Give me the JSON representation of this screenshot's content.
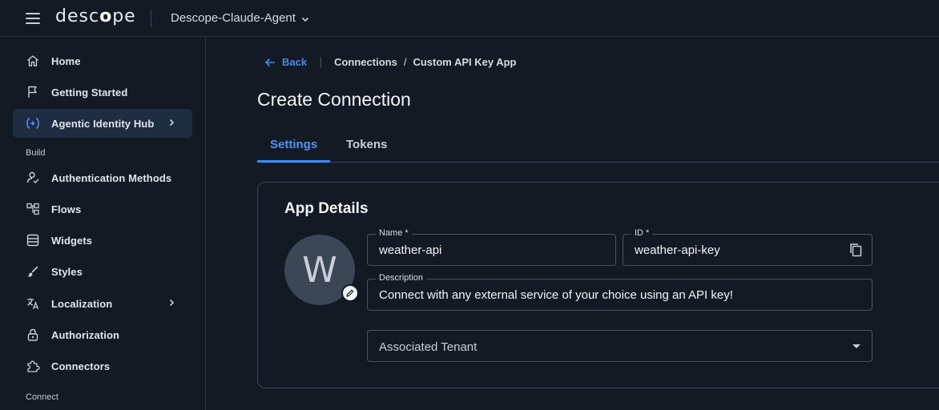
{
  "topbar": {
    "logo_pre": "desc",
    "logo_mid": "o",
    "logo_post": "pe",
    "project_name": "Descope-Claude-Agent"
  },
  "sidebar": {
    "items": [
      {
        "label": "Home",
        "icon": "home-icon"
      },
      {
        "label": "Getting Started",
        "icon": "flag-icon"
      },
      {
        "label": "Agentic Identity Hub",
        "icon": "agentic-hub-icon"
      },
      {
        "label": "Authentication Methods",
        "icon": "user-check-icon"
      },
      {
        "label": "Flows",
        "icon": "flows-icon"
      },
      {
        "label": "Widgets",
        "icon": "widgets-icon"
      },
      {
        "label": "Styles",
        "icon": "brush-icon"
      },
      {
        "label": "Localization",
        "icon": "translate-icon"
      },
      {
        "label": "Authorization",
        "icon": "lock-icon"
      },
      {
        "label": "Connectors",
        "icon": "puzzle-icon"
      }
    ],
    "sections": {
      "build": "Build",
      "connect": "Connect"
    }
  },
  "breadcrumbs": {
    "back_label": "Back",
    "connections": "Connections",
    "separator": "/",
    "current": "Custom API Key App"
  },
  "page": {
    "title": "Create Connection",
    "tabs": [
      "Settings",
      "Tokens"
    ]
  },
  "app_details": {
    "title": "App Details",
    "avatar_letter": "W",
    "name_label": "Name *",
    "name_value": "weather-api",
    "id_label": "ID *",
    "id_value": "weather-api-key",
    "description_label": "Description",
    "description_value": "Connect with any external service of your choice using an API key!",
    "tenant_placeholder": "Associated Tenant"
  },
  "colors": {
    "accent": "#3a8df5",
    "background": "#141a23",
    "active_nav": "#1f2d42",
    "border": "#3a4452"
  }
}
